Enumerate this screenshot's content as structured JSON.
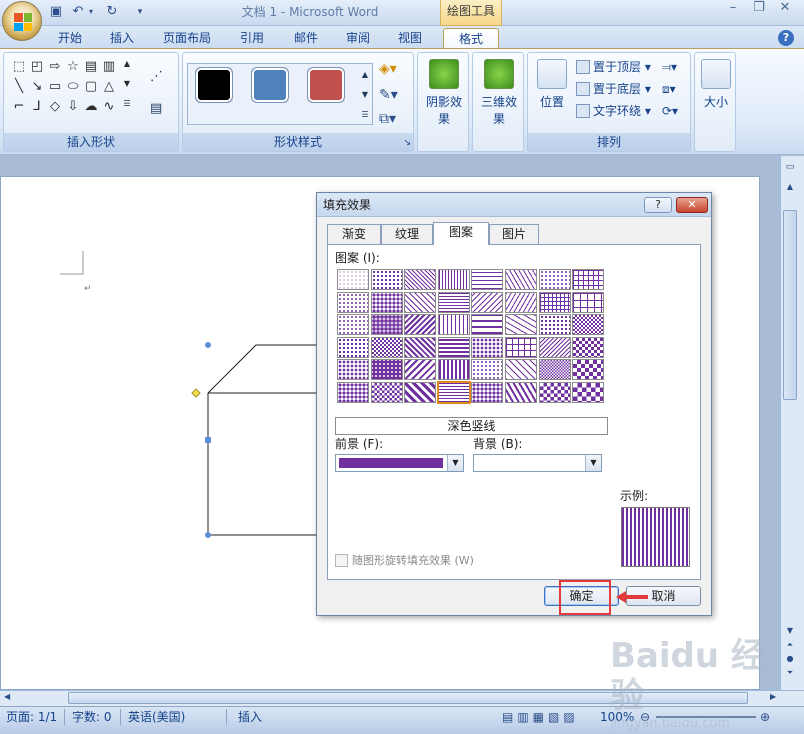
{
  "window": {
    "title": "文档 1 - Microsoft Word",
    "context_tab_group": "绘图工具"
  },
  "qat": {
    "save_icon": "save-icon",
    "undo_icon": "undo-icon",
    "redo_icon": "redo-icon"
  },
  "tabs": [
    "开始",
    "插入",
    "页面布局",
    "引用",
    "邮件",
    "审阅",
    "视图",
    "格式"
  ],
  "active_tab": "格式",
  "ribbon": {
    "insert_shapes": {
      "label": "插入形状"
    },
    "shape_styles": {
      "label": "形状样式",
      "swatches": [
        "#000000",
        "#4f81bd",
        "#c0504d"
      ]
    },
    "shadow_effects": {
      "label": "阴影效果"
    },
    "3d_effects": {
      "label": "三维效果"
    },
    "position": {
      "label": "位置"
    },
    "bring_front": {
      "label": "置于顶层"
    },
    "send_back": {
      "label": "置于底层"
    },
    "text_wrap": {
      "label": "文字环绕"
    },
    "arrange": {
      "label": "排列"
    },
    "size": {
      "label": "大小"
    }
  },
  "statusbar": {
    "page": "页面: 1/1",
    "words": "字数: 0",
    "language": "英语(美国)",
    "mode": "插入",
    "zoom": "100%"
  },
  "dialog": {
    "title": "填充效果",
    "help_label": "?",
    "close_label": "✕",
    "tabs": [
      "渐变",
      "纹理",
      "图案",
      "图片"
    ],
    "active_tab": "图案",
    "pattern_label": "图案 (I):",
    "selected_pattern_name": "深色竖线",
    "foreground_label": "前景 (F):",
    "background_label": "背景 (B):",
    "foreground_color": "#7030a0",
    "background_color": "#ffffff",
    "preview_label": "示例:",
    "rotate_label": "随图形旋转填充效果 (W)",
    "rotate_checked": false,
    "ok_label": "确定",
    "cancel_label": "取消",
    "patterns_rows": 6,
    "patterns_cols": 8,
    "selected_index": 43
  },
  "watermark": {
    "brand": "Baidu 经验",
    "url": "jingyan.baidu.com"
  }
}
